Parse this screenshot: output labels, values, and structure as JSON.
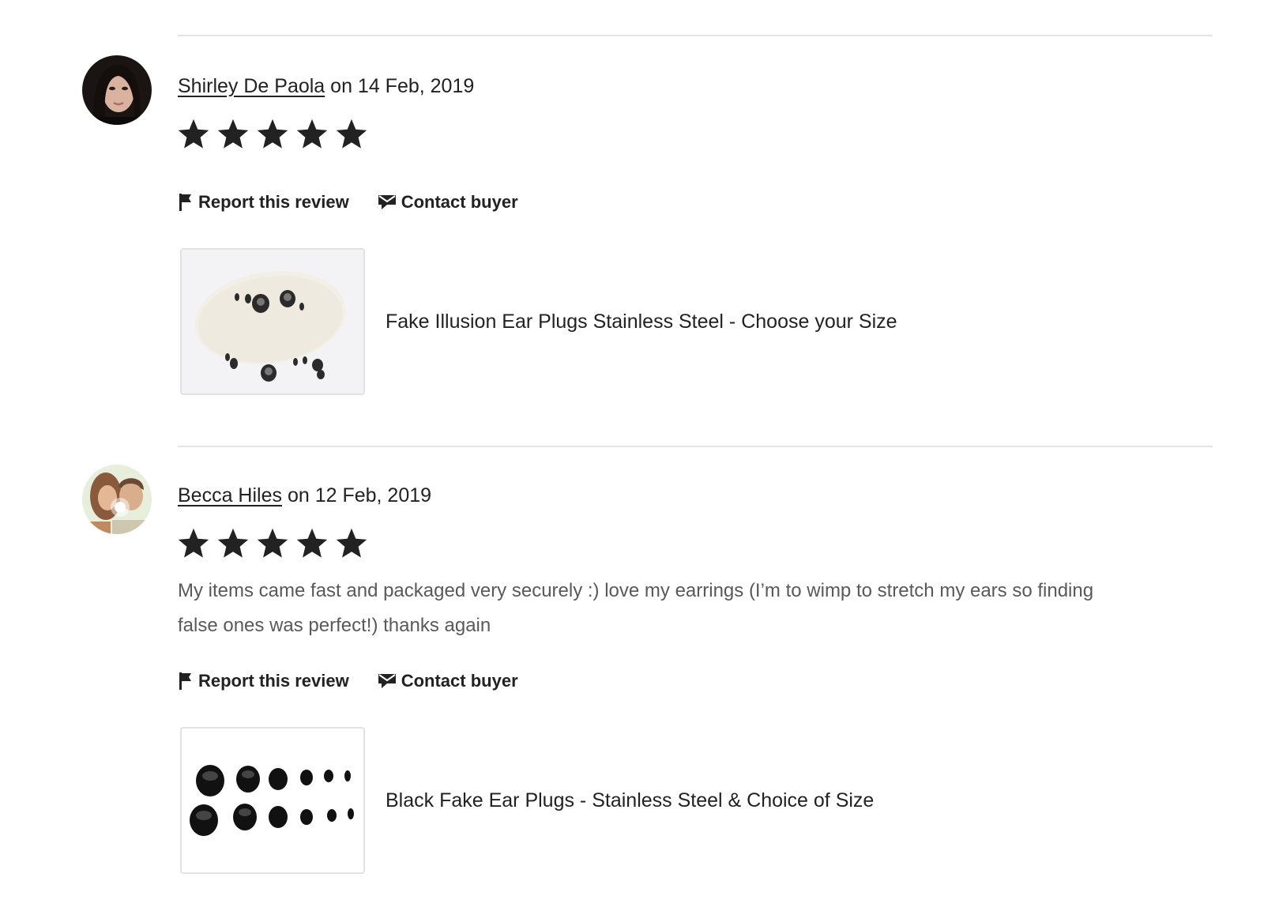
{
  "reviews": [
    {
      "author": "Shirley De Paola",
      "date_text": " on 14 Feb, 2019",
      "rating": 5,
      "rating_max": 5,
      "text": "",
      "actions": {
        "report": "Report this review",
        "contact": "Contact buyer"
      },
      "product": {
        "title": "Fake Illusion Ear Plugs Stainless Steel - Choose your Size"
      }
    },
    {
      "author": "Becca Hiles",
      "date_text": " on 12 Feb, 2019",
      "rating": 5,
      "rating_max": 5,
      "text": "My items came fast and packaged very securely :) love my earrings (I’m to wimp to stretch my ears so finding false ones was perfect!) thanks again",
      "actions": {
        "report": "Report this review",
        "contact": "Contact buyer"
      },
      "product": {
        "title": "Black Fake Ear Plugs - Stainless Steel & Choice of Size"
      }
    }
  ],
  "icons": {
    "flag": "flag-icon",
    "contact": "message-icon",
    "star": "star-icon"
  },
  "colors": {
    "text": "#222222",
    "muted": "#595959",
    "divider": "#e4e4e4"
  }
}
